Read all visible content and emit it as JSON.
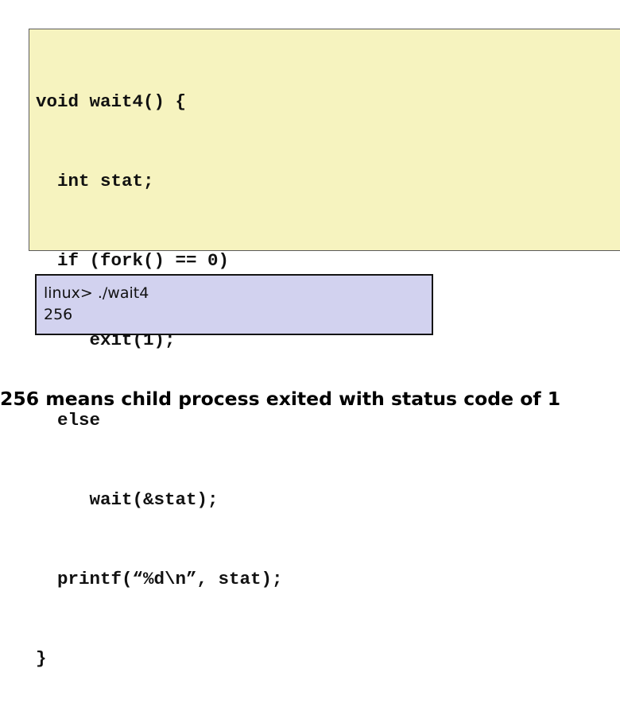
{
  "code": {
    "lines": [
      "void wait4() {",
      "  int stat;",
      "  if (fork() == 0)",
      "     exit(1);",
      "  else",
      "     wait(&stat);",
      "  printf(“%d\\n”, stat);",
      "}"
    ]
  },
  "terminal": {
    "lines": [
      "linux> ./wait4",
      "256"
    ]
  },
  "caption": "256 means child process exited with status code of 1",
  "colors": {
    "code_background": "#f6f3bf",
    "terminal_background": "#d2d2ef"
  }
}
